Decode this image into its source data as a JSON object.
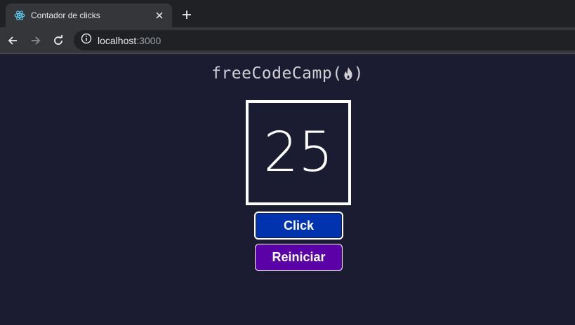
{
  "browser": {
    "tab_title": "Contador de clicks",
    "url_host": "localhost",
    "url_port": ":3000"
  },
  "app": {
    "logo_text_left": "freeCodeCamp(",
    "logo_text_right": ")",
    "count": "25",
    "click_label": "Click",
    "reset_label": "Reiniciar"
  },
  "colors": {
    "page_background": "#1b1b32",
    "click_button": "#0033ad",
    "reset_button": "#5a01a7"
  }
}
